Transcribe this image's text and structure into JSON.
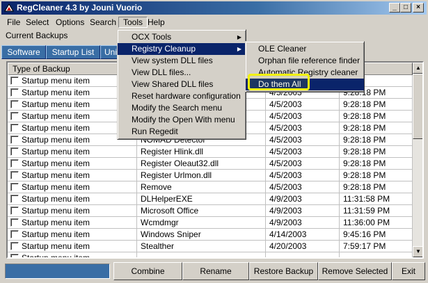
{
  "window": {
    "title": "RegCleaner 4.3 by Jouni Vuorio"
  },
  "caption_buttons": {
    "minimize": "_",
    "maximize": "□",
    "close": "×"
  },
  "menubar": {
    "items": [
      "File",
      "Select",
      "Options",
      "Search",
      "Tools",
      "Help"
    ],
    "active": "Tools"
  },
  "current_backups_label": "Current Backups",
  "tabs": [
    "Software",
    "Startup List",
    "Uni"
  ],
  "list": {
    "columns": [
      "Type of Backup",
      "",
      "",
      ""
    ],
    "rows": [
      [
        "Startup menu item",
        "",
        "",
        ""
      ],
      [
        "Startup menu item",
        "",
        "4/5/2003",
        "9:28:18 PM"
      ],
      [
        "Startup menu item",
        "",
        "4/5/2003",
        "9:28:18 PM"
      ],
      [
        "Startup menu item",
        "",
        "4/5/2003",
        "9:28:18 PM"
      ],
      [
        "Startup menu item",
        "",
        "4/5/2003",
        "9:28:18 PM"
      ],
      [
        "Startup menu item",
        "NOMAD Detector",
        "4/5/2003",
        "9:28:18 PM"
      ],
      [
        "Startup menu item",
        "Register Hlink.dll",
        "4/5/2003",
        "9:28:18 PM"
      ],
      [
        "Startup menu item",
        "Register Oleaut32.dll",
        "4/5/2003",
        "9:28:18 PM"
      ],
      [
        "Startup menu item",
        "Register Urlmon.dll",
        "4/5/2003",
        "9:28:18 PM"
      ],
      [
        "Startup menu item",
        "Remove",
        "4/5/2003",
        "9:28:18 PM"
      ],
      [
        "Startup menu item",
        "DLHelperEXE",
        "4/9/2003",
        "11:31:58 PM"
      ],
      [
        "Startup menu item",
        "Microsoft Office",
        "4/9/2003",
        "11:31:59 PM"
      ],
      [
        "Startup menu item",
        "Wcmdmgr",
        "4/9/2003",
        "11:36:00 PM"
      ],
      [
        "Startup menu item",
        "Windows Sniper",
        "4/14/2003",
        "9:45:16 PM"
      ],
      [
        "Startup menu item",
        "Stealther",
        "4/20/2003",
        "7:59:17 PM"
      ],
      [
        "Startup menu item",
        "",
        "",
        ""
      ]
    ]
  },
  "bottom_buttons": [
    "Combine",
    "Rename",
    "Restore Backup",
    "Remove Selected",
    "Exit"
  ],
  "tools_menu": {
    "items": [
      "OCX Tools",
      "Registry Cleanup",
      "View system DLL files",
      "View DLL files...",
      "View Shared DLL files",
      "Reset hardware configuration",
      "Modify the Search menu",
      "Modify the Open With menu",
      "Run Regedit"
    ],
    "highlighted": "Registry Cleanup"
  },
  "registry_cleanup_submenu": {
    "items": [
      "OLE Cleaner",
      "Orphan file reference finder",
      "Automatic Registry cleaner",
      "Do them All"
    ],
    "highlighted": "Do them All"
  },
  "colors": {
    "selection": "#0a246a",
    "tab_blue": "#3a6ea5",
    "annotation": "#f2f20a"
  }
}
